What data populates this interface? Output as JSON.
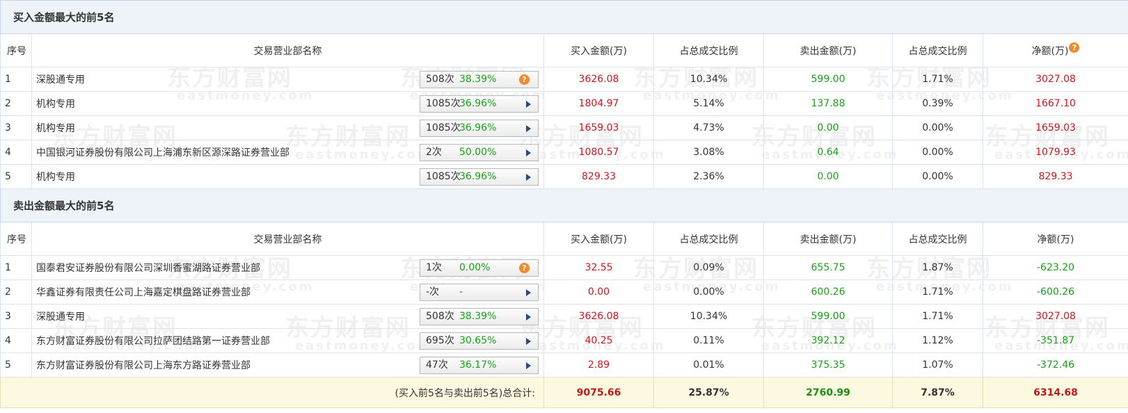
{
  "watermark": {
    "cn": "东方财富网",
    "en": "eastmoney.com"
  },
  "buy_section": {
    "title": "买入金额最大的前5名",
    "headers": [
      "序号",
      "交易营业部名称",
      "买入金额(万)",
      "占总成交比例",
      "卖出金额(万)",
      "占总成交比例",
      "净额(万)"
    ],
    "rows": [
      {
        "idx": "1",
        "name": "深股通专用",
        "count": "508次",
        "pct": "38.39%",
        "action": "question",
        "buy": "3626.08",
        "buy_ratio": "10.34%",
        "sell": "599.00",
        "sell_ratio": "1.71%",
        "net": "3027.08"
      },
      {
        "idx": "2",
        "name": "机构专用",
        "count": "1085次",
        "pct": "36.96%",
        "action": "arrow",
        "buy": "1804.97",
        "buy_ratio": "5.14%",
        "sell": "137.88",
        "sell_ratio": "0.39%",
        "net": "1667.10"
      },
      {
        "idx": "3",
        "name": "机构专用",
        "count": "1085次",
        "pct": "36.96%",
        "action": "arrow",
        "buy": "1659.03",
        "buy_ratio": "4.73%",
        "sell": "0.00",
        "sell_ratio": "0.00%",
        "net": "1659.03"
      },
      {
        "idx": "4",
        "name": "中国银河证券股份有限公司上海浦东新区源深路证券营业部",
        "count": "2次",
        "pct": "50.00%",
        "action": "arrow",
        "buy": "1080.57",
        "buy_ratio": "3.08%",
        "sell": "0.64",
        "sell_ratio": "0.00%",
        "net": "1079.93"
      },
      {
        "idx": "5",
        "name": "机构专用",
        "count": "1085次",
        "pct": "36.96%",
        "action": "arrow",
        "buy": "829.33",
        "buy_ratio": "2.36%",
        "sell": "0.00",
        "sell_ratio": "0.00%",
        "net": "829.33"
      }
    ]
  },
  "sell_section": {
    "title": "卖出金额最大的前5名",
    "headers": [
      "序号",
      "交易营业部名称",
      "买入金额(万)",
      "占总成交比例",
      "卖出金额(万)",
      "占总成交比例",
      "净额(万)"
    ],
    "rows": [
      {
        "idx": "1",
        "name": "国泰君安证券股份有限公司深圳香蜜湖路证券营业部",
        "count": "1次",
        "pct": "0.00%",
        "action": "question",
        "buy": "32.55",
        "buy_ratio": "0.09%",
        "sell": "655.75",
        "sell_ratio": "1.87%",
        "net": "-623.20"
      },
      {
        "idx": "2",
        "name": "华鑫证券有限责任公司上海嘉定棋盘路证券营业部",
        "count": "-次",
        "pct": "-",
        "action": "arrow",
        "buy": "0.00",
        "buy_ratio": "0.00%",
        "sell": "600.26",
        "sell_ratio": "1.71%",
        "net": "-600.26"
      },
      {
        "idx": "3",
        "name": "深股通专用",
        "count": "508次",
        "pct": "38.39%",
        "action": "arrow",
        "buy": "3626.08",
        "buy_ratio": "10.34%",
        "sell": "599.00",
        "sell_ratio": "1.71%",
        "net": "3027.08"
      },
      {
        "idx": "4",
        "name": "东方财富证券股份有限公司拉萨团结路第一证券营业部",
        "count": "695次",
        "pct": "30.65%",
        "action": "arrow",
        "buy": "40.25",
        "buy_ratio": "0.11%",
        "sell": "392.12",
        "sell_ratio": "1.12%",
        "net": "-351.87"
      },
      {
        "idx": "5",
        "name": "东方财富证券股份有限公司上海东方路证券营业部",
        "count": "47次",
        "pct": "36.17%",
        "action": "arrow",
        "buy": "2.89",
        "buy_ratio": "0.01%",
        "sell": "375.35",
        "sell_ratio": "1.07%",
        "net": "-372.46"
      }
    ]
  },
  "total": {
    "label": "(买入前5名与卖出前5名)总合计:",
    "buy": "9075.66",
    "buy_ratio": "25.87%",
    "sell": "2760.99",
    "sell_ratio": "7.87%",
    "net": "6314.68"
  },
  "colors": {
    "positive": "#d0161b",
    "negative": "#18a218",
    "help_icon": "#f08a2c",
    "arrow": "#2b4a7a"
  },
  "icons": {
    "question": "question-circle-icon",
    "arrow": "play-arrow-icon"
  }
}
